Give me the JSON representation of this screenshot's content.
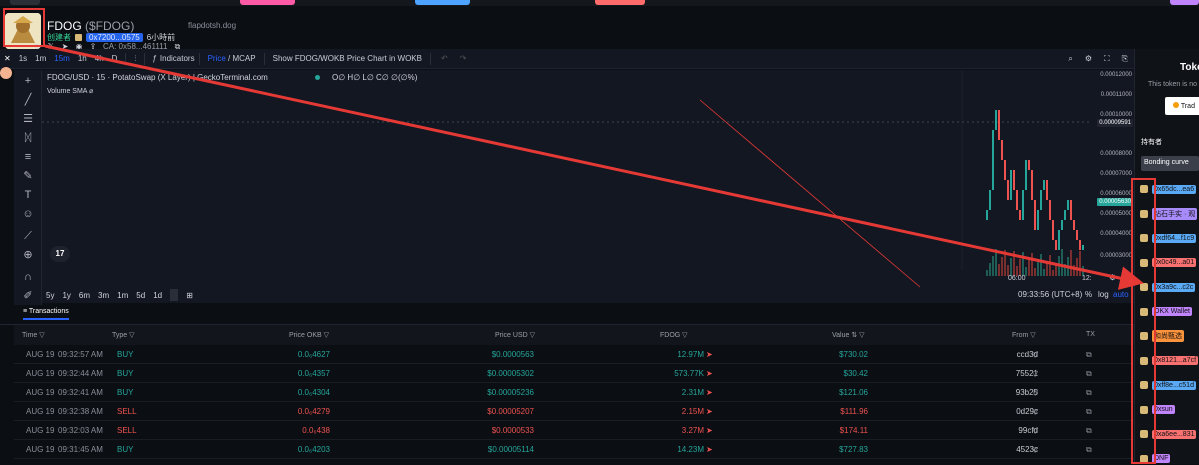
{
  "colors": {
    "accent": "#2962ff",
    "buy": "#26a69a",
    "sell": "#ef5350",
    "annotation": "#e53935"
  },
  "token": {
    "name": "FDOG",
    "symbol": "($FDOG)",
    "site": "flapdotsh.dog",
    "creator_label": "创建者",
    "address_short": "0x7200...0575",
    "age": "6小時前",
    "ca": "CA: 0x58...461111"
  },
  "chart_toolbar": {
    "intervals": [
      "1s",
      "1m",
      "15m",
      "1h",
      "4h",
      "D"
    ],
    "active_interval": "15m",
    "indicators": "Indicators",
    "price": "Price",
    "mcap": "MCAP",
    "show_chart": "Show FDOG/WOKB Price Chart in WOKB"
  },
  "chart": {
    "title": "FDOG/USD · 15 · PotatoSwap (X Layer) | GeckoTerminal.com",
    "ohlc": "O∅ H∅ L∅ C∅ ∅(∅%)",
    "volume_label": "Volume SMA",
    "y_ticks": [
      "0.00012000",
      "0.00011000",
      "0.00010000",
      "0.00009591",
      "0.00008000",
      "0.00007000",
      "0.00006000",
      "0.00005630",
      "0.00005000",
      "0.00004000",
      "0.00003000"
    ],
    "crosshair_price": "0.00009591",
    "last_price": "0.00005630",
    "x_tick": "06:00",
    "x_tick2": "12:"
  },
  "bottom_tools": {
    "ranges": [
      "5y",
      "1y",
      "6m",
      "3m",
      "1m",
      "5d",
      "1d"
    ],
    "clock": "09:33:56 (UTC+8)",
    "pct": "%",
    "log": "log",
    "auto": "auto"
  },
  "transactions": {
    "tab": "Transactions",
    "headers": {
      "time": "Time",
      "type": "Type",
      "price_okb": "Price OKB",
      "price_usd": "Price USD",
      "amount": "FDOG",
      "value": "Value",
      "from": "From",
      "tx": "TX"
    },
    "rows": [
      {
        "date": "AUG 19",
        "time": "09:32:57 AM",
        "type": "BUY",
        "okb": "0.0₆4627",
        "usd": "$0.0000563",
        "amount": "12.97M",
        "value": "$730.02",
        "from": "ccd3d"
      },
      {
        "date": "AUG 19",
        "time": "09:32:44 AM",
        "type": "BUY",
        "okb": "0.0₆4357",
        "usd": "$0.00005302",
        "amount": "573.77K",
        "value": "$30.42",
        "from": "75521"
      },
      {
        "date": "AUG 19",
        "time": "09:32:41 AM",
        "type": "BUY",
        "okb": "0.0₆4304",
        "usd": "$0.00005236",
        "amount": "2.31M",
        "value": "$121.06",
        "from": "93b25"
      },
      {
        "date": "AUG 19",
        "time": "09:32:38 AM",
        "type": "SELL",
        "okb": "0.0₆4279",
        "usd": "$0.00005207",
        "amount": "2.15M",
        "value": "$111.96",
        "from": "0d29c"
      },
      {
        "date": "AUG 19",
        "time": "09:32:03 AM",
        "type": "SELL",
        "okb": "0.0₆438",
        "usd": "$0.0000533",
        "amount": "3.27M",
        "value": "$174.11",
        "from": "99cfd"
      },
      {
        "date": "AUG 19",
        "time": "09:31:45 AM",
        "type": "BUY",
        "okb": "0.0₆4203",
        "usd": "$0.00005114",
        "amount": "14.23M",
        "value": "$727.83",
        "from": "4523c"
      }
    ]
  },
  "side_panel": {
    "title": "Toke",
    "subtitle": "This token is no",
    "trade_btn": "Trad",
    "holders": "持有者",
    "bonding": "Bonding curve",
    "holder_list": [
      {
        "label": "0x65dc...ea6",
        "color": "#5aa9f5"
      },
      {
        "label": "钻石手实 · 观",
        "color": "#a78bfa"
      },
      {
        "label": "0xdf64...f1c9",
        "color": "#5aa9f5"
      },
      {
        "label": "0x0c49...a01",
        "color": "#f87171"
      },
      {
        "label": "0x3a9c...c2c",
        "color": "#5aa9f5"
      },
      {
        "label": "OKX Wallet",
        "color": "#c084fc"
      },
      {
        "label": "和尚甄选",
        "color": "#fb923c"
      },
      {
        "label": "0x8121...a7cf",
        "color": "#f87171"
      },
      {
        "label": "0xff8e...c51d",
        "color": "#5aa9f5"
      },
      {
        "label": "0xsun",
        "color": "#c084fc"
      },
      {
        "label": "0xa6ee...831",
        "color": "#f87171"
      },
      {
        "label": "DNF",
        "color": "#c084fc"
      }
    ]
  }
}
